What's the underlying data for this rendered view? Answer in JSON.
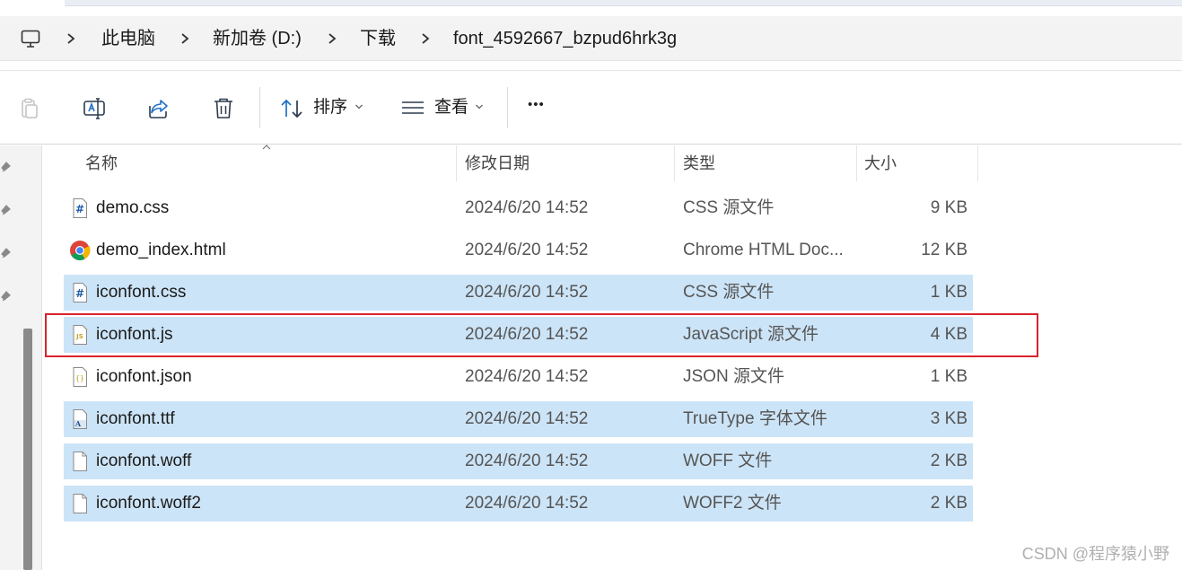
{
  "breadcrumb": {
    "icon": "this-pc-icon",
    "items": [
      "此电脑",
      "新加卷 (D:)",
      "下载",
      "font_4592667_bzpud6hrk3g"
    ]
  },
  "toolbar": {
    "paste_icon": "paste-icon",
    "rename_icon": "rename-icon",
    "share_icon": "share-icon",
    "delete_icon": "trash-icon",
    "sort_label": "排序",
    "view_label": "查看",
    "more_label": "•••"
  },
  "columns": {
    "name": "名称",
    "date": "修改日期",
    "type": "类型",
    "size": "大小"
  },
  "files": [
    {
      "name": "demo.css",
      "date": "2024/6/20 14:52",
      "type": "CSS 源文件",
      "size": "9 KB",
      "icon": "css-file-icon",
      "selected": false
    },
    {
      "name": "demo_index.html",
      "date": "2024/6/20 14:52",
      "type": "Chrome HTML Doc...",
      "size": "12 KB",
      "icon": "chrome-icon",
      "selected": false
    },
    {
      "name": "iconfont.css",
      "date": "2024/6/20 14:52",
      "type": "CSS 源文件",
      "size": "1 KB",
      "icon": "css-file-icon",
      "selected": true
    },
    {
      "name": "iconfont.js",
      "date": "2024/6/20 14:52",
      "type": "JavaScript 源文件",
      "size": "4 KB",
      "icon": "js-file-icon",
      "selected": true
    },
    {
      "name": "iconfont.json",
      "date": "2024/6/20 14:52",
      "type": "JSON 源文件",
      "size": "1 KB",
      "icon": "json-file-icon",
      "selected": false
    },
    {
      "name": "iconfont.ttf",
      "date": "2024/6/20 14:52",
      "type": "TrueType 字体文件",
      "size": "3 KB",
      "icon": "font-file-icon",
      "selected": true
    },
    {
      "name": "iconfont.woff",
      "date": "2024/6/20 14:52",
      "type": "WOFF 文件",
      "size": "2 KB",
      "icon": "blank-file-icon",
      "selected": true
    },
    {
      "name": "iconfont.woff2",
      "date": "2024/6/20 14:52",
      "type": "WOFF2 文件",
      "size": "2 KB",
      "icon": "blank-file-icon",
      "selected": true
    }
  ],
  "colors": {
    "selection": "#cce4f7",
    "highlight_box": "#d9232e"
  },
  "watermark": "CSDN @程序猿小野"
}
